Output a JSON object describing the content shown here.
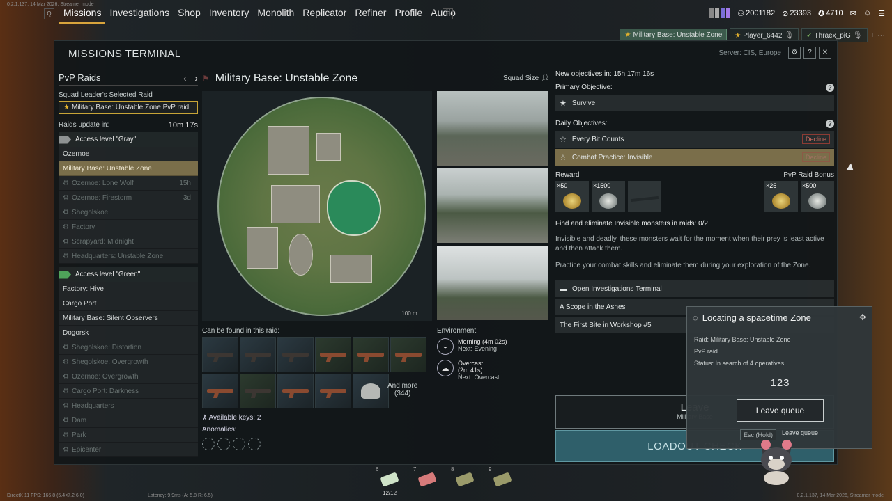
{
  "top": {
    "build_tag": "0.2.1.137, 14 Mar 2026, Streamer mode",
    "key_left": "Q",
    "key_right": "E",
    "nav": [
      "Missions",
      "Investigations",
      "Shop",
      "Inventory",
      "Monolith",
      "Replicator",
      "Refiner",
      "Profile",
      "Audio"
    ],
    "active_nav": "Missions",
    "currency": {
      "a": "2001182",
      "b": "23393",
      "c": "4710"
    }
  },
  "players": {
    "raid_tag": "Military Base: Unstable Zone",
    "p1": "Player_6442",
    "p2": "Thraex_piG"
  },
  "terminal": {
    "title": "MISSIONS TERMINAL",
    "server": "Server: CIS, Europe"
  },
  "raids": {
    "header": "PvP Raids",
    "leader_label": "Squad Leader's Selected Raid",
    "leader_value": "Military Base: Unstable Zone PvP raid",
    "update_label": "Raids update in:",
    "update_value": "10m 17s",
    "access_gray": "Access level \"Gray\"",
    "gray_items": [
      {
        "name": "Ozernoe",
        "state": "normal",
        "time": ""
      },
      {
        "name": "Military Base: Unstable Zone",
        "state": "selected",
        "time": ""
      },
      {
        "name": "Ozernoe: Lone Wolf",
        "state": "disabled",
        "time": "15h"
      },
      {
        "name": "Ozernoe: Firestorm",
        "state": "disabled",
        "time": "3d"
      },
      {
        "name": "Shegolskoe",
        "state": "disabled",
        "time": ""
      },
      {
        "name": "Factory",
        "state": "disabled",
        "time": ""
      },
      {
        "name": "Scrapyard: Midnight",
        "state": "disabled",
        "time": ""
      },
      {
        "name": "Headquarters: Unstable Zone",
        "state": "disabled",
        "time": ""
      }
    ],
    "access_green": "Access level \"Green\"",
    "green_items": [
      {
        "name": "Factory: Hive",
        "state": "normal"
      },
      {
        "name": "Cargo Port",
        "state": "normal"
      },
      {
        "name": "Military Base: Silent Observers",
        "state": "normal"
      },
      {
        "name": "Dogorsk",
        "state": "normal"
      },
      {
        "name": "Shegolskoe: Distortion",
        "state": "disabled"
      },
      {
        "name": "Shegolskoe: Overgrowth",
        "state": "disabled"
      },
      {
        "name": "Ozernoe: Overgrowth",
        "state": "disabled"
      },
      {
        "name": "Cargo Port: Darkness",
        "state": "disabled"
      },
      {
        "name": "Headquarters",
        "state": "disabled"
      },
      {
        "name": "Dam",
        "state": "disabled"
      },
      {
        "name": "Park",
        "state": "disabled"
      },
      {
        "name": "Epicenter",
        "state": "disabled"
      }
    ]
  },
  "map": {
    "title": "Military Base: Unstable Zone",
    "squad_label": "Squad Size",
    "scale": "100 m",
    "found_label": "Can be found in this raid:",
    "more_label": "And more",
    "more_count": "(344)",
    "keys": "Available keys: 2",
    "anomalies": "Anomalies:"
  },
  "environment": {
    "label": "Environment:",
    "time_main": "Morning (4m 02s)",
    "time_next": "Next: Evening",
    "weather_main": "Overcast",
    "weather_dur": "(2m 41s)",
    "weather_next": "Next: Overcast"
  },
  "objectives": {
    "new_in": "New objectives in: 15h 17m 16s",
    "primary_label": "Primary Objective:",
    "primary": "Survive",
    "daily_label": "Daily Objectives:",
    "daily": [
      {
        "name": "Every Bit Counts",
        "selected": false
      },
      {
        "name": "Combat Practice: Invisible",
        "selected": true
      }
    ],
    "decline": "Decline",
    "reward_label": "Reward",
    "bonus_label": "PvP Raid Bonus",
    "reward_counts": [
      "×50",
      "×1500"
    ],
    "bonus_counts": [
      "×25",
      "×500"
    ],
    "task": "Find and eliminate Invisible monsters in raids: 0/2",
    "desc1": "Invisible and deadly, these monsters wait for the moment when their prey is least active and then attack them.",
    "desc2": "Practice your combat skills and eliminate them during your exploration of the Zone.",
    "inv_terminal": "Open Investigations Terminal",
    "inv_items": [
      "A Scope in the Ashes",
      "The First Bite in Workshop #5"
    ]
  },
  "actions": {
    "leave": "Leave",
    "leave_sub": "Military Base",
    "loadout": "LOADOUT CHECK"
  },
  "locating": {
    "title": "Locating a spacetime Zone",
    "raid": "Raid: Military Base: Unstable Zone",
    "mode": "PvP raid",
    "status": "Status: In search of 4 operatives",
    "count": "123",
    "button": "Leave queue",
    "hint_key": "Esc (Hold)",
    "hint_text": "Leave queue"
  },
  "hotbar": [
    {
      "n": "6",
      "q": "12/12"
    },
    {
      "n": "7",
      "q": ""
    },
    {
      "n": "8",
      "q": ""
    },
    {
      "n": "9",
      "q": ""
    }
  ],
  "bottom": {
    "stats": "DirectX 11 FPS: 166.8 (5.4<7.2 6.0)",
    "latency": "Latency: 9.9ms (A: 5.8 R: 6.5)",
    "build": "0.2.1.137, 14 Mar 2026, Streamer mode"
  }
}
